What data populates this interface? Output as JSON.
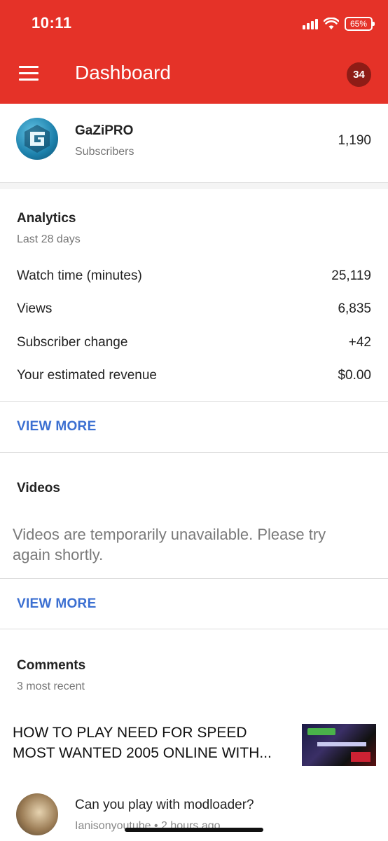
{
  "status_bar": {
    "time": "10:11",
    "battery": "65%"
  },
  "header": {
    "title": "Dashboard",
    "notification_count": "34"
  },
  "channel": {
    "name": "GaZiPRO",
    "subscribers_label": "Subscribers",
    "subscribers_count": "1,190"
  },
  "analytics": {
    "title": "Analytics",
    "period": "Last 28 days",
    "metrics": [
      {
        "label": "Watch time (minutes)",
        "value": "25,119"
      },
      {
        "label": "Views",
        "value": "6,835"
      },
      {
        "label": "Subscriber change",
        "value": "+42"
      },
      {
        "label": "Your estimated revenue",
        "value": "$0.00"
      }
    ],
    "view_more": "VIEW MORE"
  },
  "videos": {
    "title": "Videos",
    "message": "Videos are temporarily unavailable. Please try again shortly.",
    "view_more": "VIEW MORE"
  },
  "comments": {
    "title": "Comments",
    "subtitle": "3 most recent",
    "video_title": "HOW TO PLAY NEED FOR SPEED MOST WANTED 2005 ONLINE WITH...",
    "items": [
      {
        "text": "Can you play with modloader?",
        "meta": "Ianisonyoutube • 2 hours ago"
      }
    ]
  },
  "colors": {
    "header": "#e53228",
    "badge": "#8e1c16",
    "link": "#3b6fd1"
  }
}
